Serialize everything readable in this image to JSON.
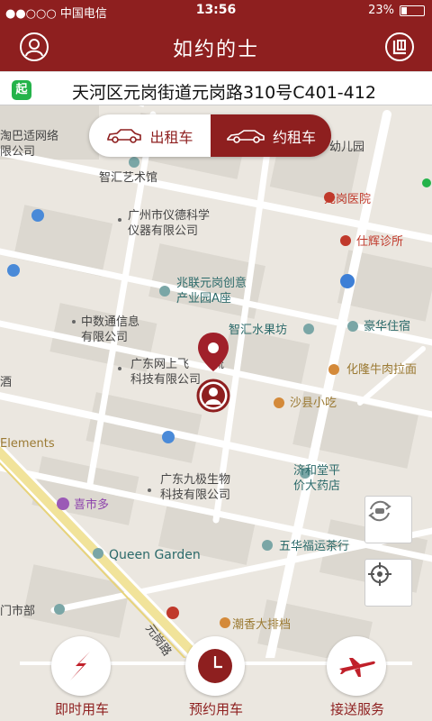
{
  "status_bar": {
    "carrier": "●●○○○ 中国电信",
    "time": "13:56",
    "battery": "23%"
  },
  "header": {
    "title": "如约的士"
  },
  "address": {
    "start_badge": "起",
    "text": "天河区元岗街道元岗路310号C401-412"
  },
  "car_type": {
    "taxi_label": "出租车",
    "premium_label": "约租车",
    "selected": "约租车"
  },
  "map": {
    "labels": {
      "l1": "淘巴适网络\n限公司",
      "l2": "智汇艺术馆",
      "l3": "广州市仪德科学\n仪器有限公司",
      "l4": "兆联元岗创意\n产业园A座",
      "l5": "中数通信息\n有限公司",
      "l6": "广东网上飞　　流\n科技有限公司",
      "l7": "智汇水果坊",
      "l8": "豪华住宿",
      "l9": "化隆牛肉拉面",
      "l10": "沙县小吃",
      "l11": "Elements",
      "l12": "广东九极生物\n科技有限公司",
      "l13": "济和堂平\n价大药店",
      "l14": "喜市多",
      "l15": "Queen Garden",
      "l16": "五华福运茶行",
      "l17": "门市部",
      "l18": "潮香大排档",
      "l19": "元岗医院",
      "l20": "仕辉诊所",
      "l21": "幼儿园",
      "l22": "酒",
      "l23": "元岗路"
    }
  },
  "services": [
    {
      "label": "即时用车"
    },
    {
      "label": "预约用车"
    },
    {
      "label": "接送服务"
    }
  ],
  "colors": {
    "brand": "#8e1f1f",
    "map_bg": "#ebe7e0",
    "start_badge": "#24b34a"
  }
}
